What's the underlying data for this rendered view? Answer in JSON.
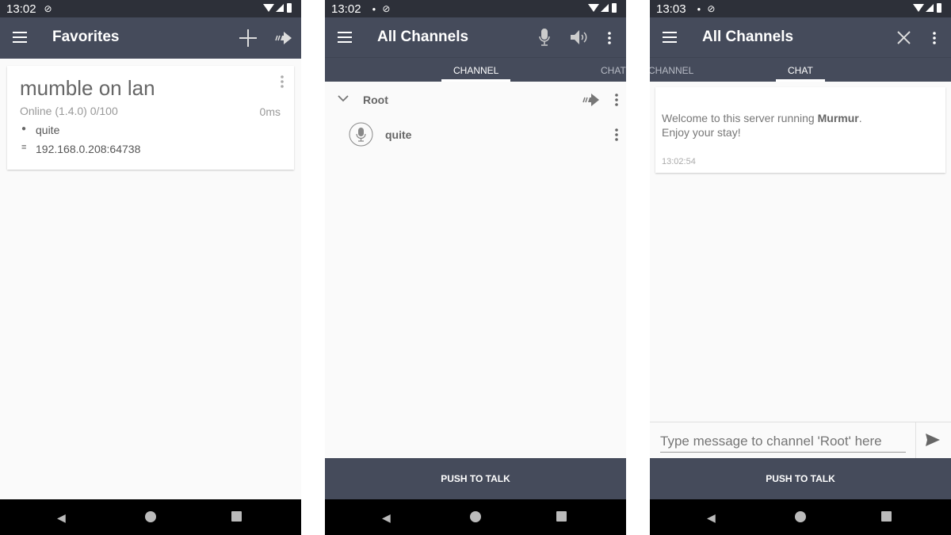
{
  "screens": [
    {
      "status_time": "13:02",
      "title": "Favorites",
      "server": {
        "name": "mumble on lan",
        "status": "Online (1.4.0)  0/100",
        "ping": "0ms",
        "user": "quite",
        "address": "192.168.0.208:64738"
      }
    },
    {
      "status_time": "13:02",
      "title": "All Channels",
      "tabs": [
        "CHANNEL",
        "CHAT"
      ],
      "channel": {
        "name": "Root",
        "users": [
          "quite"
        ]
      },
      "push_to_talk": "PUSH TO TALK"
    },
    {
      "status_time": "13:03",
      "title": "All Channels",
      "tabs": [
        "CHANNEL",
        "CHAT"
      ],
      "message": {
        "text_prefix": "Welcome to this server running ",
        "bold": "Murmur",
        "text_suffix": ".",
        "line2": "Enjoy your stay!",
        "time": "13:02:54"
      },
      "input_placeholder": "Type message to channel 'Root' here",
      "push_to_talk": "PUSH TO TALK"
    }
  ],
  "colors": {
    "toolbar": "#454b5b",
    "status_bar": "#2d3039",
    "background": "#fafafa"
  }
}
